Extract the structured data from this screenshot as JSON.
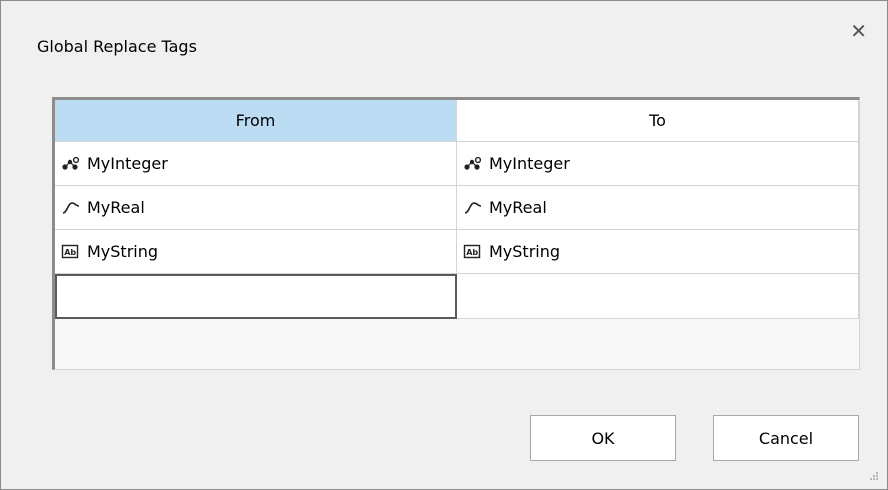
{
  "dialog": {
    "title": "Global Replace Tags",
    "close_icon": "close-icon"
  },
  "grid": {
    "columns": [
      "From",
      "To"
    ],
    "rows": [
      {
        "icon": "integer-tag-icon",
        "from": "MyInteger",
        "to": "MyInteger"
      },
      {
        "icon": "real-tag-icon",
        "from": "MyReal",
        "to": "MyReal"
      },
      {
        "icon": "string-tag-icon",
        "from": "MyString",
        "to": "MyString"
      }
    ],
    "new_row": {
      "from": "",
      "to": ""
    }
  },
  "buttons": {
    "ok": "OK",
    "cancel": "Cancel"
  },
  "colors": {
    "header_active": "#bcdcf4",
    "dialog_bg": "#f0f0f0"
  }
}
